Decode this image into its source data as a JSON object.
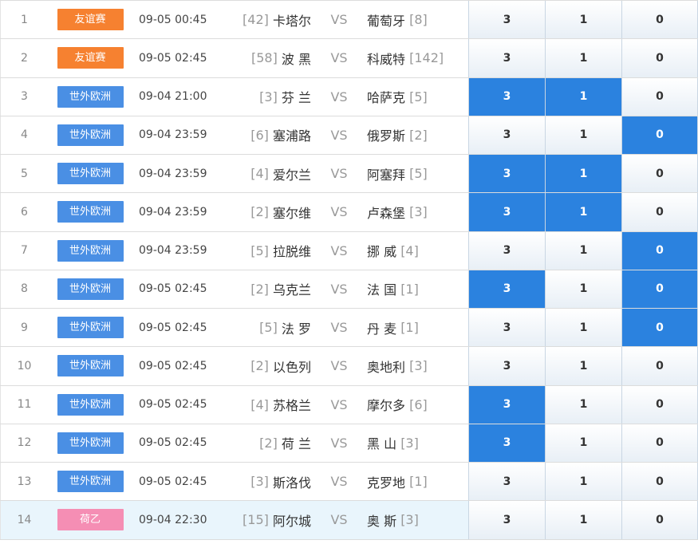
{
  "vs_label": "VS",
  "colors": {
    "friendly": "#f68130",
    "wcq_europe": "#4a8fe4",
    "eredivisie_2": "#f58eb4",
    "selected": "#2b82df",
    "highlight_row": "#e9f5fc"
  },
  "rows": [
    {
      "no": "1",
      "league": "友谊赛",
      "league_type": "friendly",
      "time": "09-05 00:45",
      "home_rank": "[42]",
      "home": "卡塔尔",
      "away": "葡萄牙",
      "away_rank": "[8]",
      "options": [
        {
          "label": "3",
          "selected": false
        },
        {
          "label": "1",
          "selected": false
        },
        {
          "label": "0",
          "selected": false
        }
      ]
    },
    {
      "no": "2",
      "league": "友谊赛",
      "league_type": "friendly",
      "time": "09-05 02:45",
      "home_rank": "[58]",
      "home": "波 黑",
      "away": "科威特",
      "away_rank": "[142]",
      "options": [
        {
          "label": "3",
          "selected": false
        },
        {
          "label": "1",
          "selected": false
        },
        {
          "label": "0",
          "selected": false
        }
      ]
    },
    {
      "no": "3",
      "league": "世外欧洲",
      "league_type": "wcq_europe",
      "time": "09-04 21:00",
      "home_rank": "[3]",
      "home": "芬 兰",
      "away": "哈萨克",
      "away_rank": "[5]",
      "options": [
        {
          "label": "3",
          "selected": true
        },
        {
          "label": "1",
          "selected": true
        },
        {
          "label": "0",
          "selected": false
        }
      ]
    },
    {
      "no": "4",
      "league": "世外欧洲",
      "league_type": "wcq_europe",
      "time": "09-04 23:59",
      "home_rank": "[6]",
      "home": "塞浦路",
      "away": "俄罗斯",
      "away_rank": "[2]",
      "options": [
        {
          "label": "3",
          "selected": false
        },
        {
          "label": "1",
          "selected": false
        },
        {
          "label": "0",
          "selected": true
        }
      ]
    },
    {
      "no": "5",
      "league": "世外欧洲",
      "league_type": "wcq_europe",
      "time": "09-04 23:59",
      "home_rank": "[4]",
      "home": "爱尔兰",
      "away": "阿塞拜",
      "away_rank": "[5]",
      "options": [
        {
          "label": "3",
          "selected": true
        },
        {
          "label": "1",
          "selected": true
        },
        {
          "label": "0",
          "selected": false
        }
      ]
    },
    {
      "no": "6",
      "league": "世外欧洲",
      "league_type": "wcq_europe",
      "time": "09-04 23:59",
      "home_rank": "[2]",
      "home": "塞尔维",
      "away": "卢森堡",
      "away_rank": "[3]",
      "options": [
        {
          "label": "3",
          "selected": true
        },
        {
          "label": "1",
          "selected": true
        },
        {
          "label": "0",
          "selected": false
        }
      ]
    },
    {
      "no": "7",
      "league": "世外欧洲",
      "league_type": "wcq_europe",
      "time": "09-04 23:59",
      "home_rank": "[5]",
      "home": "拉脱维",
      "away": "挪 威",
      "away_rank": "[4]",
      "options": [
        {
          "label": "3",
          "selected": false
        },
        {
          "label": "1",
          "selected": false
        },
        {
          "label": "0",
          "selected": true
        }
      ]
    },
    {
      "no": "8",
      "league": "世外欧洲",
      "league_type": "wcq_europe",
      "time": "09-05 02:45",
      "home_rank": "[2]",
      "home": "乌克兰",
      "away": "法 国",
      "away_rank": "[1]",
      "options": [
        {
          "label": "3",
          "selected": true
        },
        {
          "label": "1",
          "selected": false
        },
        {
          "label": "0",
          "selected": true
        }
      ]
    },
    {
      "no": "9",
      "league": "世外欧洲",
      "league_type": "wcq_europe",
      "time": "09-05 02:45",
      "home_rank": "[5]",
      "home": "法 罗",
      "away": "丹 麦",
      "away_rank": "[1]",
      "options": [
        {
          "label": "3",
          "selected": false
        },
        {
          "label": "1",
          "selected": false
        },
        {
          "label": "0",
          "selected": true
        }
      ]
    },
    {
      "no": "10",
      "league": "世外欧洲",
      "league_type": "wcq_europe",
      "time": "09-05 02:45",
      "home_rank": "[2]",
      "home": "以色列",
      "away": "奥地利",
      "away_rank": "[3]",
      "options": [
        {
          "label": "3",
          "selected": false
        },
        {
          "label": "1",
          "selected": false
        },
        {
          "label": "0",
          "selected": false
        }
      ]
    },
    {
      "no": "11",
      "league": "世外欧洲",
      "league_type": "wcq_europe",
      "time": "09-05 02:45",
      "home_rank": "[4]",
      "home": "苏格兰",
      "away": "摩尔多",
      "away_rank": "[6]",
      "options": [
        {
          "label": "3",
          "selected": true
        },
        {
          "label": "1",
          "selected": false
        },
        {
          "label": "0",
          "selected": false
        }
      ]
    },
    {
      "no": "12",
      "league": "世外欧洲",
      "league_type": "wcq_europe",
      "time": "09-05 02:45",
      "home_rank": "[2]",
      "home": "荷 兰",
      "away": "黑 山",
      "away_rank": "[3]",
      "options": [
        {
          "label": "3",
          "selected": true
        },
        {
          "label": "1",
          "selected": false
        },
        {
          "label": "0",
          "selected": false
        }
      ]
    },
    {
      "no": "13",
      "league": "世外欧洲",
      "league_type": "wcq_europe",
      "time": "09-05 02:45",
      "home_rank": "[3]",
      "home": "斯洛伐",
      "away": "克罗地",
      "away_rank": "[1]",
      "options": [
        {
          "label": "3",
          "selected": false
        },
        {
          "label": "1",
          "selected": false
        },
        {
          "label": "0",
          "selected": false
        }
      ]
    },
    {
      "no": "14",
      "league": "荷乙",
      "league_type": "eredivisie_2",
      "time": "09-04 22:30",
      "home_rank": "[15]",
      "home": "阿尔城",
      "away": "奥 斯",
      "away_rank": "[3]",
      "highlight": true,
      "options": [
        {
          "label": "3",
          "selected": false
        },
        {
          "label": "1",
          "selected": false
        },
        {
          "label": "0",
          "selected": false
        }
      ]
    }
  ]
}
